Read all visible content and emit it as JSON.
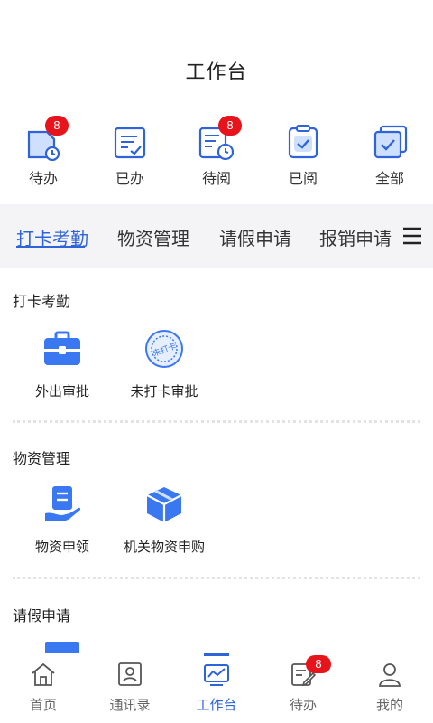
{
  "header": {
    "title": "工作台"
  },
  "quick_actions": [
    {
      "label": "待办",
      "icon": "todo-doc-clock-icon",
      "badge": "8"
    },
    {
      "label": "已办",
      "icon": "done-doc-check-icon",
      "badge": null
    },
    {
      "label": "待阅",
      "icon": "to-read-doc-clock-icon",
      "badge": "8"
    },
    {
      "label": "已阅",
      "icon": "read-clipboard-check-icon",
      "badge": null
    },
    {
      "label": "全部",
      "icon": "all-stack-check-icon",
      "badge": null
    }
  ],
  "tabs": [
    {
      "label": "打卡考勤",
      "active": true
    },
    {
      "label": "物资管理",
      "active": false
    },
    {
      "label": "请假申请",
      "active": false
    },
    {
      "label": "报销申请",
      "active": false
    }
  ],
  "sections": [
    {
      "title": "打卡考勤",
      "apps": [
        {
          "label": "外出审批",
          "icon": "briefcase-icon"
        },
        {
          "label": "未打卡审批",
          "icon": "stamp-seal-icon",
          "seal_text": "未打卡"
        }
      ]
    },
    {
      "title": "物资管理",
      "apps": [
        {
          "label": "物资申领",
          "icon": "hand-receive-doc-icon"
        },
        {
          "label": "机关物资申购",
          "icon": "package-box-icon"
        }
      ]
    },
    {
      "title": "请假申请",
      "apps": []
    }
  ],
  "bottom_nav": [
    {
      "label": "首页",
      "icon": "home-icon",
      "active": false,
      "badge": null
    },
    {
      "label": "通讯录",
      "icon": "contacts-icon",
      "active": false,
      "badge": null
    },
    {
      "label": "工作台",
      "icon": "workbench-chart-icon",
      "active": true,
      "badge": null
    },
    {
      "label": "待办",
      "icon": "todo-edit-icon",
      "active": false,
      "badge": "8"
    },
    {
      "label": "我的",
      "icon": "profile-icon",
      "active": false,
      "badge": null
    }
  ],
  "colors": {
    "accent": "#2f63d9",
    "badge": "#e8141b",
    "icon_fill": "#3a78f2",
    "tab_bg": "#f4f4f6"
  }
}
